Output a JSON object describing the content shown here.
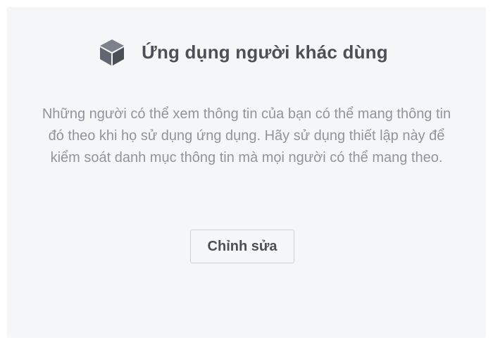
{
  "section": {
    "icon": "cube-icon",
    "title": "Ứng dụng người khác dùng",
    "description": "Những người có thể xem thông tin của bạn có thể mang thông tin đó theo khi họ sử dụng ứng dụng. Hãy sử dụng thiết lập này để kiểm soát danh mục thông tin mà mọi người có thể mang theo.",
    "edit_button_label": "Chỉnh sửa"
  },
  "colors": {
    "card_background": "#f5f6f7",
    "title_text": "#4b4f56",
    "description_text": "#90949c",
    "icon": "#606770",
    "button_border": "#ced0d4"
  }
}
